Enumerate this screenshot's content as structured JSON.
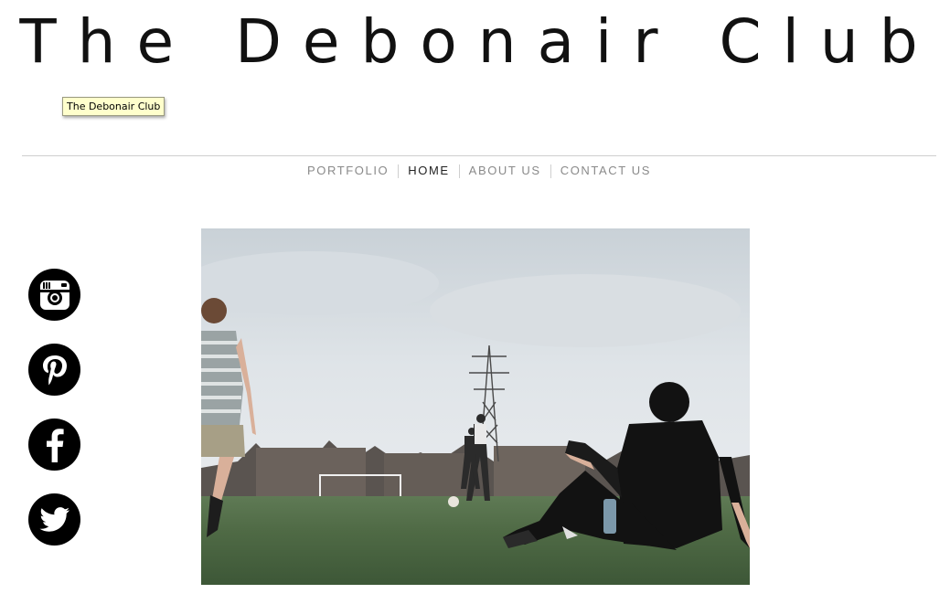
{
  "site": {
    "title": "The Debonair Club"
  },
  "tooltip": {
    "text": "The Debonair Club"
  },
  "nav": {
    "items": [
      {
        "label": "PORTFOLIO",
        "active": false
      },
      {
        "label": "HOME",
        "active": true
      },
      {
        "label": "ABOUT US",
        "active": false
      },
      {
        "label": "CONTACT US",
        "active": false
      }
    ]
  },
  "social": {
    "icons": [
      "instagram-icon",
      "pinterest-icon",
      "facebook-icon",
      "twitter-icon"
    ]
  },
  "hero": {
    "subject": "photo-icon"
  },
  "colors": {
    "text": "#111111",
    "nav_inactive": "#8a8a8a",
    "nav_active": "#222222",
    "divider": "#cfcfcf",
    "tooltip_bg": "#ffffcc"
  }
}
